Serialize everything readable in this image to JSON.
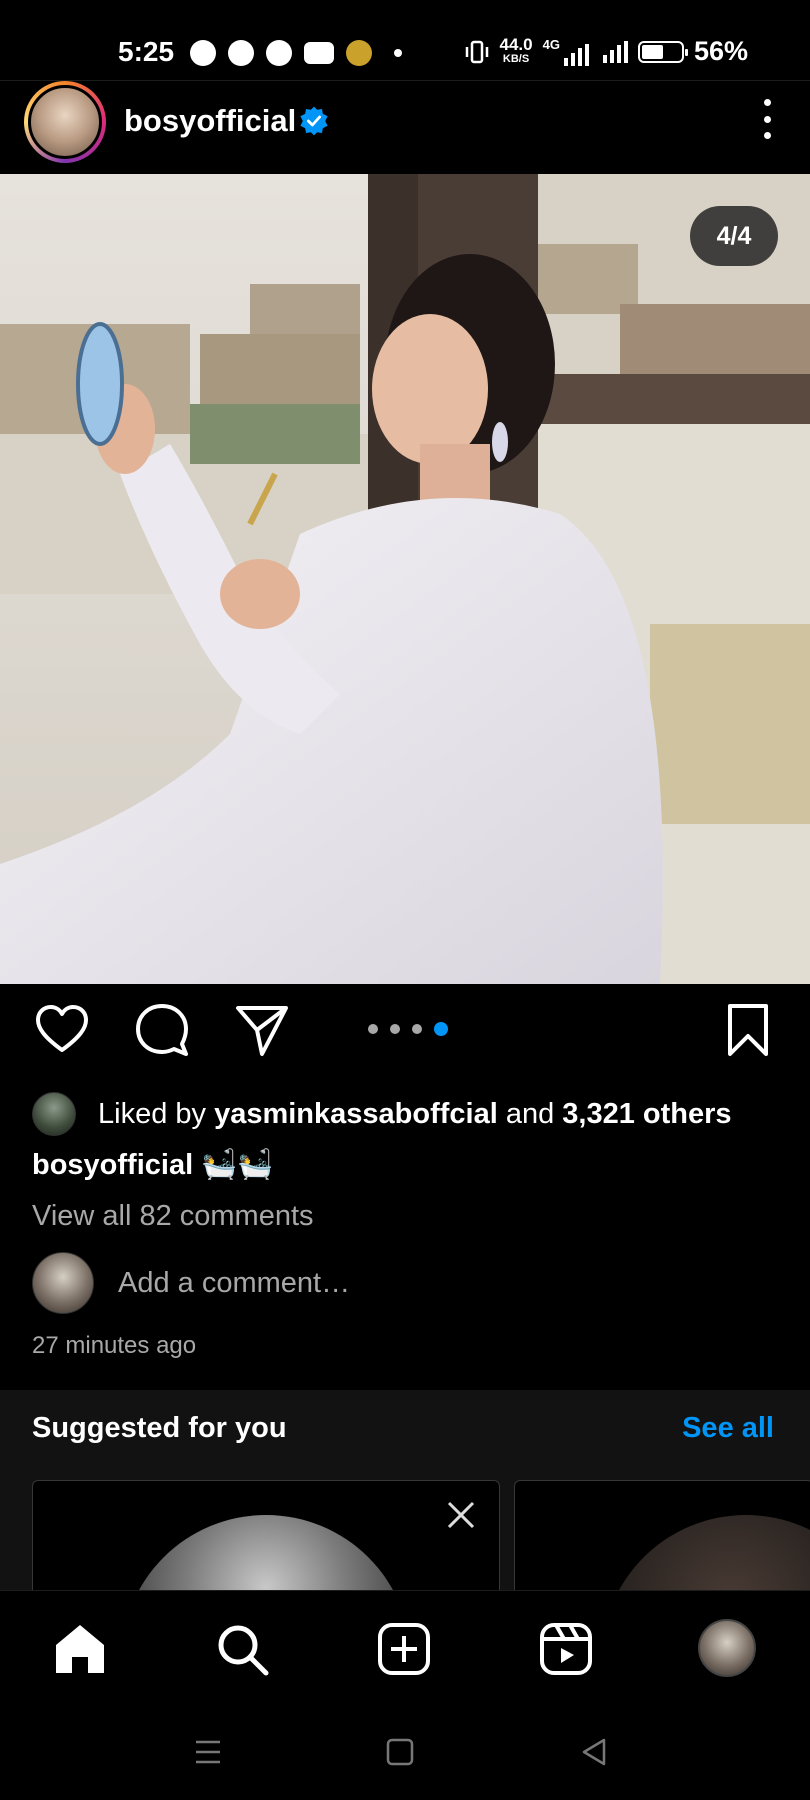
{
  "status_bar": {
    "time": "5:25",
    "net_speed_value": "44.0",
    "net_speed_unit": "KB/S",
    "network": "4G",
    "battery": "56%",
    "battery_level": 0.56
  },
  "post": {
    "username": "bosyofficial",
    "verified": true,
    "image_counter": "4/4",
    "carousel_total": 4,
    "carousel_active": 4,
    "likes": {
      "prefix": "Liked by",
      "liker": "yasminkassaboffcial",
      "and": "and",
      "others": "3,321 others"
    },
    "caption": {
      "username": "bosyofficial",
      "text": "🛀🛀"
    },
    "view_comments": "View all 82 comments",
    "add_comment_placeholder": "Add a comment…",
    "time_ago": "27 minutes ago"
  },
  "suggested": {
    "title": "Suggested for you",
    "see_all": "See all"
  },
  "colors": {
    "accent": "#0095f6",
    "background": "#000000",
    "muted_text": "#a8a8a8"
  },
  "icons": {
    "actions": [
      "heart-icon",
      "comment-icon",
      "share-icon",
      "bookmark-icon"
    ],
    "bottom_nav": [
      "home-icon",
      "search-icon",
      "create-icon",
      "reels-icon",
      "profile-avatar"
    ]
  }
}
